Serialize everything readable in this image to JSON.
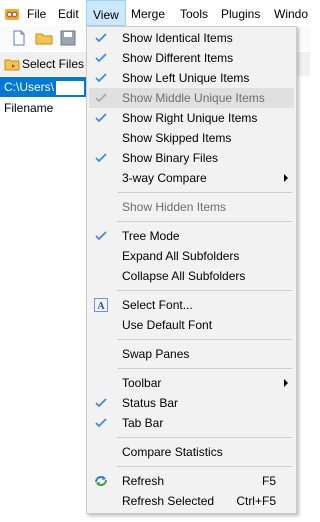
{
  "menubar": {
    "items": [
      {
        "label": "File"
      },
      {
        "label": "Edit"
      },
      {
        "label": "View"
      },
      {
        "label": "Merge"
      },
      {
        "label": "Tools"
      },
      {
        "label": "Plugins"
      },
      {
        "label": "Windo"
      }
    ]
  },
  "tab": {
    "label": "Select Files or"
  },
  "path": {
    "value": "C:\\Users\\"
  },
  "column": {
    "filename": "Filename"
  },
  "view_menu": {
    "items": [
      {
        "label": "Show Identical Items",
        "checked": true
      },
      {
        "label": "Show Different Items",
        "checked": true
      },
      {
        "label": "Show Left Unique Items",
        "checked": true
      },
      {
        "label": "Show Middle Unique Items",
        "checked": true,
        "disabled": true
      },
      {
        "label": "Show Right Unique Items",
        "checked": true
      },
      {
        "label": "Show Skipped Items",
        "checked": false
      },
      {
        "label": "Show Binary Files",
        "checked": true
      },
      {
        "label": "3-way Compare",
        "submenu": true
      },
      {
        "label": "Show Hidden Items",
        "disabled": true
      },
      {
        "label": "Tree Mode",
        "checked": true
      },
      {
        "label": "Expand All Subfolders"
      },
      {
        "label": "Collapse All Subfolders"
      },
      {
        "label": "Select Font...",
        "icon": "font-icon"
      },
      {
        "label": "Use Default Font"
      },
      {
        "label": "Swap Panes"
      },
      {
        "label": "Toolbar",
        "submenu": true
      },
      {
        "label": "Status Bar",
        "checked": true
      },
      {
        "label": "Tab Bar",
        "checked": true
      },
      {
        "label": "Compare Statistics"
      },
      {
        "label": "Refresh",
        "shortcut": "F5",
        "icon": "refresh-icon"
      },
      {
        "label": "Refresh Selected",
        "shortcut": "Ctrl+F5"
      }
    ]
  },
  "colors": {
    "accent": "#0078d7",
    "check": "#3a8de0",
    "menu_bg": "#f2f2f2",
    "highlight": "#e0e0e0"
  }
}
